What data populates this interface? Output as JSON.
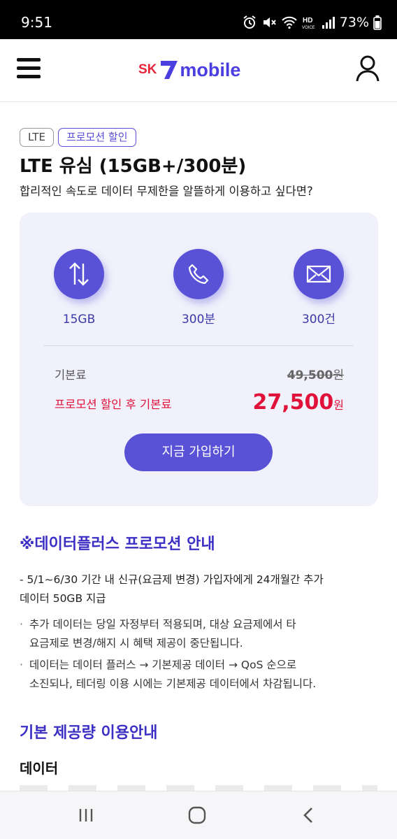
{
  "status_bar": {
    "time": "9:51",
    "battery": "73%",
    "icons": [
      "alarm-icon",
      "mute-icon",
      "wifi-icon",
      "hd-voice-icon",
      "signal-icon",
      "battery-icon"
    ]
  },
  "header": {
    "logo_sk": "SK",
    "logo_mobile": "mobile",
    "menu_icon": "hamburger-menu-icon",
    "user_icon": "user-profile-icon",
    "brand_red": "#e8243b",
    "brand_purple": "#4a3ee0"
  },
  "plan": {
    "badges": [
      "LTE",
      "프로모션 할인"
    ],
    "title": "LTE 유심 (15GB+/300분)",
    "description": "합리적인 속도로 데이터 무제한을 알뜰하게 이용하고 싶다면?",
    "features": [
      {
        "icon": "data-transfer-icon",
        "label": "15GB"
      },
      {
        "icon": "phone-icon",
        "label": "300분"
      },
      {
        "icon": "mail-icon",
        "label": "300건"
      }
    ],
    "base_fee_label": "기본료",
    "base_fee_value": "49,500",
    "promo_fee_label": "프로모션 할인 후 기본료",
    "promo_fee_value": "27,500",
    "currency": "원",
    "join_label": "지금 가입하기",
    "accent_color": "#5a52d6",
    "promo_color": "#e0123a"
  },
  "promo_info": {
    "title": "※데이터플러스 프로모션 안내",
    "intro_line1": "- 5/1~6/30 기간 내 신규(요금제 변경) 가입자에게 24개월간 추가",
    "intro_line2": "데이터 50GB 지급",
    "bullets": [
      {
        "line1": "추가 데이터는 당일 자정부터 적용되며, 대상 요금제에서 타",
        "line2": "요금제로 변경/해지 시 혜택 제공이 중단됩니다."
      },
      {
        "line1": "데이터는 데이터 플러스 → 기본제공 데이터 → QoS 순으로",
        "line2": "소진되나, 테더링 이용 시에는 기본제공 데이터에서 차감됩니다."
      }
    ]
  },
  "usage_info": {
    "title": "기본 제공량 이용안내",
    "data_title": "데이터"
  },
  "nav_bar": {
    "recent_icon": "recent-apps-icon",
    "home_icon": "home-icon",
    "back_icon": "back-icon"
  }
}
